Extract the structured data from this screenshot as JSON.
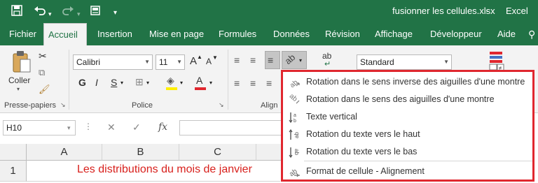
{
  "window": {
    "file_title": "fusionner les cellules.xlsx",
    "separator": "-",
    "app_name": "Excel"
  },
  "quick_access": {
    "save_icon": "save-icon",
    "undo_icon": "undo-icon",
    "redo_icon": "redo-icon",
    "form_icon": "form-icon",
    "customize_icon": "customize-qat-icon"
  },
  "tabs": [
    {
      "label": "Fichier"
    },
    {
      "label": "Accueil"
    },
    {
      "label": "Insertion"
    },
    {
      "label": "Mise en page"
    },
    {
      "label": "Formules"
    },
    {
      "label": "Données"
    },
    {
      "label": "Révision"
    },
    {
      "label": "Affichage"
    },
    {
      "label": "Développeur"
    },
    {
      "label": "Aide"
    }
  ],
  "ribbon": {
    "clipboard": {
      "paste_label": "Coller",
      "group_label": "Presse-papiers"
    },
    "font": {
      "font_name": "Calibri",
      "font_size": "11",
      "bold": "G",
      "italic": "I",
      "underline": "S",
      "grow_font": "A",
      "shrink_font": "A",
      "group_label": "Police"
    },
    "alignment": {
      "group_label": "Align",
      "wrap_icon": "ab"
    },
    "number": {
      "format": "Standard"
    }
  },
  "formula_bar": {
    "name_box": "H10",
    "fx": "fx"
  },
  "grid": {
    "columns": [
      "A",
      "B",
      "C"
    ],
    "rows": [
      "1"
    ],
    "cell_a1": "Les distributions du mois de janvier"
  },
  "orientation_menu": {
    "items": [
      {
        "label": "Rotation dans le sens inverse des aiguilles d'une montre",
        "icon": "rotate-counterclockwise-icon"
      },
      {
        "label": "Rotation dans le sens des aiguilles d'une montre",
        "icon": "rotate-clockwise-icon"
      },
      {
        "label": "Texte vertical",
        "icon": "vertical-text-icon"
      },
      {
        "label": "Rotation du texte vers le haut",
        "icon": "rotate-text-up-icon"
      },
      {
        "label": "Rotation du texte vers le bas",
        "icon": "rotate-text-down-icon"
      },
      {
        "label": "Format de cellule - Alignement",
        "icon": "format-cell-alignment-icon"
      }
    ]
  },
  "colors": {
    "excel_green": "#217346",
    "highlight_border": "#e0272f",
    "cell_text": "#d8211d"
  }
}
